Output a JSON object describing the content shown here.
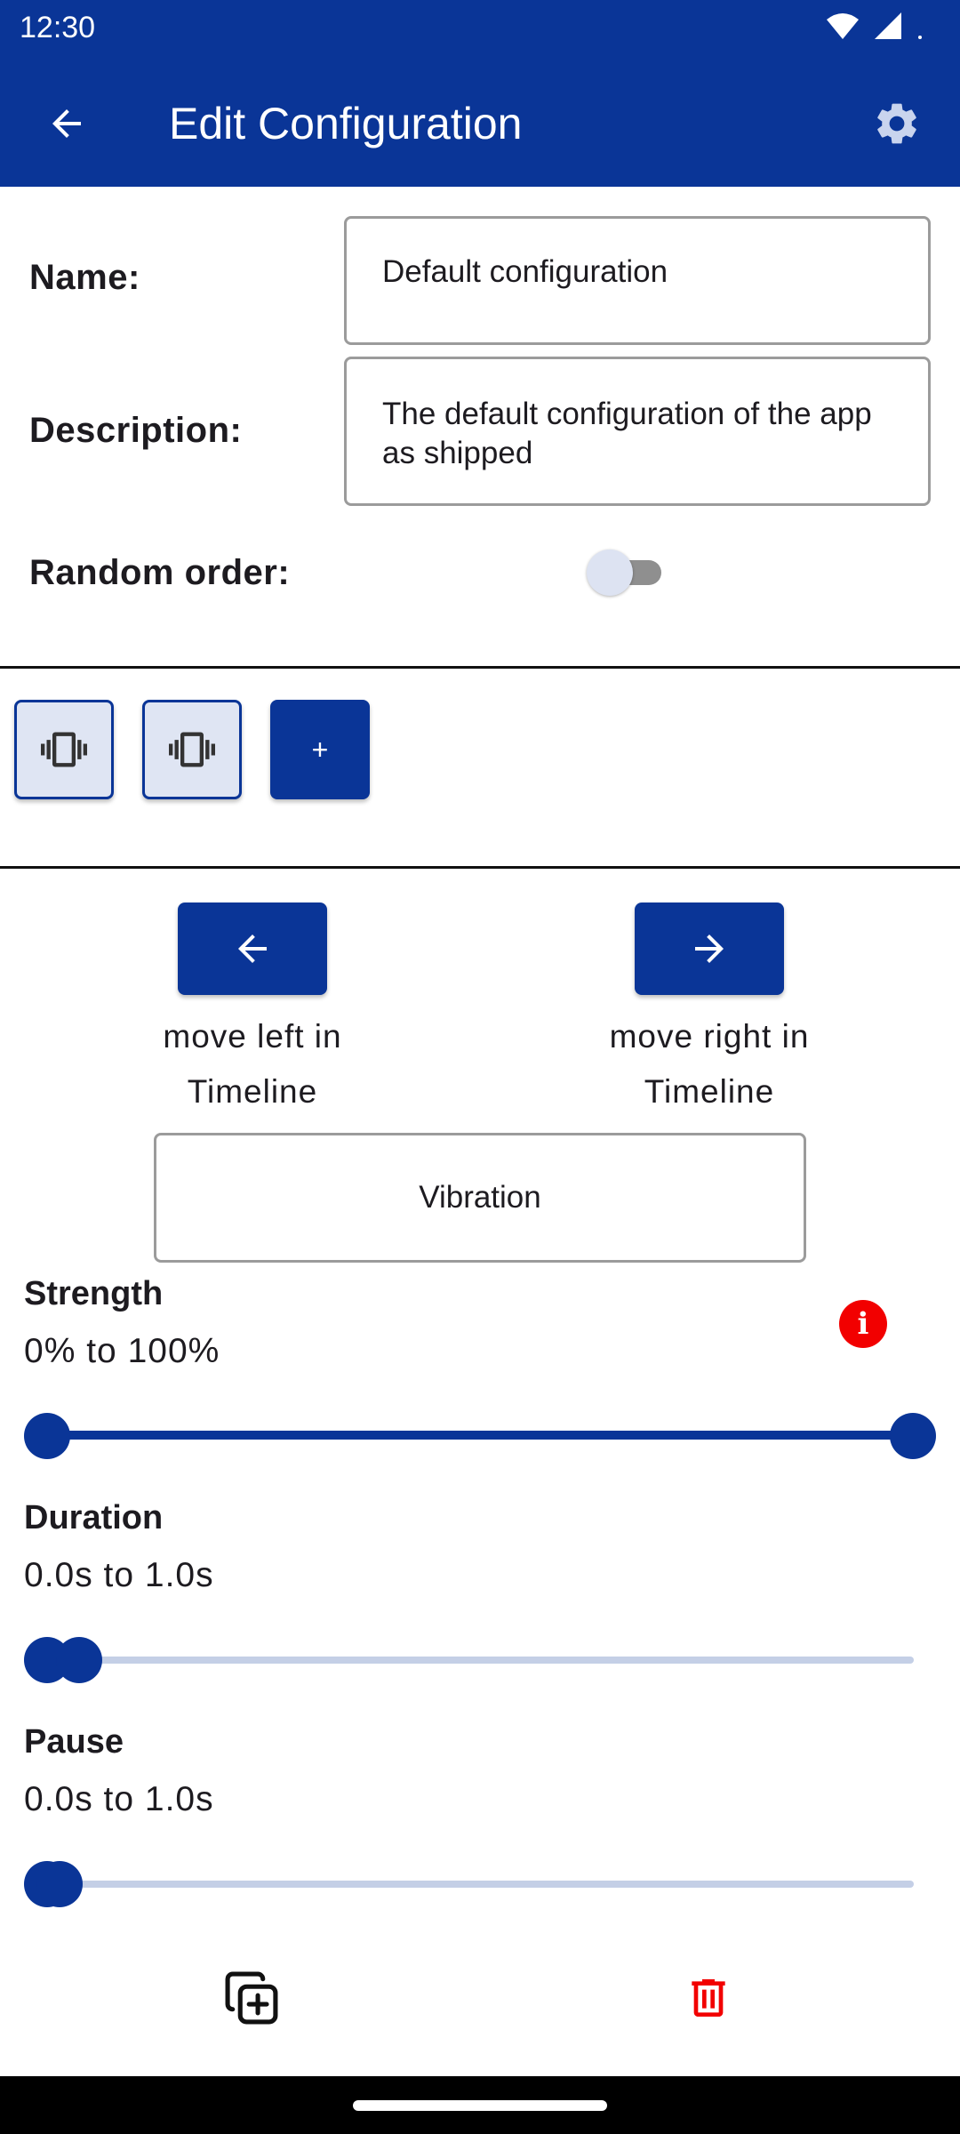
{
  "status_bar": {
    "time": "12:30"
  },
  "app_bar": {
    "title": "Edit Configuration"
  },
  "form": {
    "name_label": "Name:",
    "name_value": "Default configuration",
    "description_label": "Description:",
    "description_value": "The default configuration of the app as shipped",
    "random_order_label": "Random order:",
    "random_order_enabled": false
  },
  "timeline": {
    "tiles": [
      {
        "icon": "vibration-icon",
        "selected": true
      },
      {
        "icon": "vibration-icon",
        "selected": false
      }
    ],
    "add_label": "+"
  },
  "move": {
    "left_label": "move left in Timeline",
    "right_label": "move right in Timeline"
  },
  "element_type": "Vibration",
  "strength": {
    "title": "Strength",
    "range": "0% to 100%",
    "min": 0,
    "max": 100,
    "unit": "%",
    "low": 0,
    "high": 100
  },
  "duration": {
    "title": "Duration",
    "range": "0.0s to 1.0s",
    "min": 0.0,
    "max": 1.0,
    "unit": "s"
  },
  "pause": {
    "title": "Pause",
    "range": "0.0s to 1.0s",
    "min": 0.0,
    "max": 1.0,
    "unit": "s"
  },
  "colors": {
    "primary": "#0a3597",
    "danger": "#f20000",
    "track": "#c4cfe6"
  },
  "icons": {
    "back": "arrow-left-icon",
    "settings": "gear-icon",
    "info": "info-icon",
    "duplicate": "copy-plus-icon",
    "delete": "trash-icon"
  }
}
